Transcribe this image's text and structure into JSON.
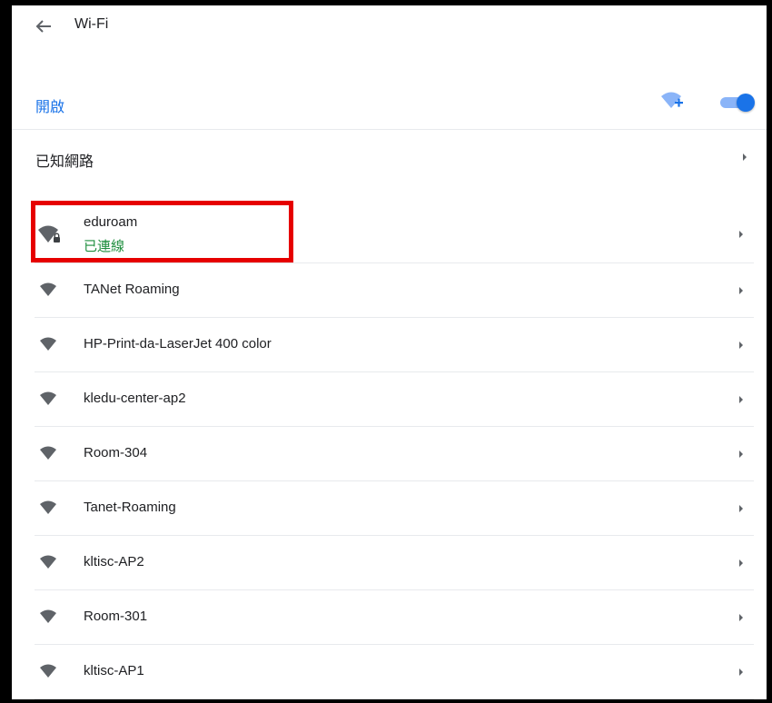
{
  "header": {
    "title": "Wi-Fi",
    "back_icon": "arrow-left-icon"
  },
  "wifi": {
    "enable_label": "開啟",
    "enabled": true,
    "add_network_icon": "wifi-add-icon",
    "accent_color": "#1a73e8"
  },
  "known_networks": {
    "label": "已知網路"
  },
  "networks": [
    {
      "name": "eduroam",
      "status": "已連線",
      "secured": true,
      "connected": true
    },
    {
      "name": "TANet Roaming",
      "secured": false
    },
    {
      "name": "HP-Print-da-LaserJet 400 color",
      "secured": false
    },
    {
      "name": "kledu-center-ap2",
      "secured": false
    },
    {
      "name": "Room-304",
      "secured": false
    },
    {
      "name": "Tanet-Roaming",
      "secured": false
    },
    {
      "name": "kltisc-AP2",
      "secured": false
    },
    {
      "name": "Room-301",
      "secured": false
    },
    {
      "name": "kltisc-AP1",
      "secured": false
    }
  ],
  "highlight_color": "#e60000",
  "connected_status_color": "#1e8e3e"
}
